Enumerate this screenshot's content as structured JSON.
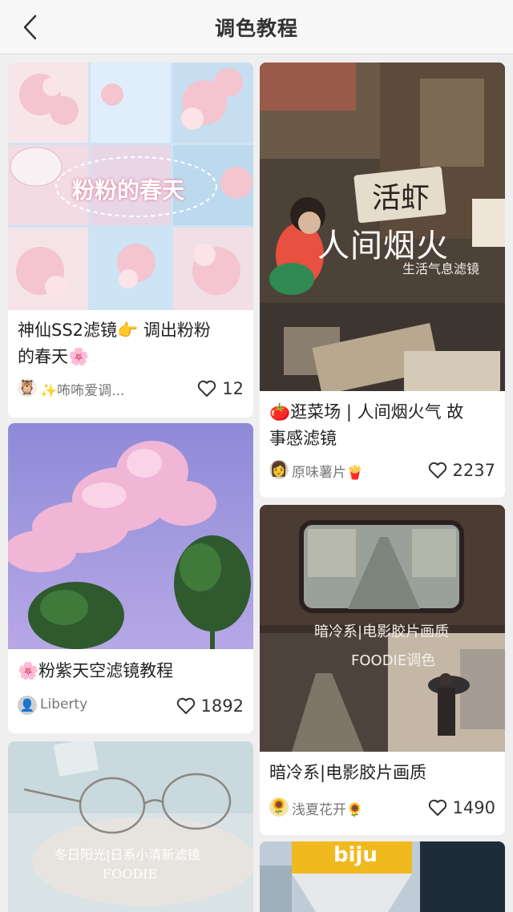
{
  "header": {
    "title": "调色教程"
  },
  "cards": [
    {
      "overlay": "粉粉的春天",
      "title": "神仙SS2滤镜👉 调出粉粉的春天🌸",
      "title_line1": "神仙SS2滤镜👉 调出粉粉",
      "title_line2": "的春天🌸",
      "avatar": "🦉",
      "author": "✨咘咘爱调...",
      "likes": "12"
    },
    {
      "overlay": "人间烟火",
      "overlay_sub": "生活气息滤镜",
      "sign": "活虾",
      "title_line1": "🍅逛菜场 | 人间烟火气 故",
      "title_line2": "事感滤镜",
      "avatar": "👩",
      "author": "原味薯片🍟",
      "likes": "2237"
    },
    {
      "title_line1": "🌸粉紫天空滤镜教程",
      "avatar": "👤",
      "author": "Liberty",
      "likes": "1892"
    },
    {
      "overlay": "暗冷系|电影胶片画质",
      "overlay_sub": "FOODIE调色",
      "title_line1": "暗冷系|电影胶片画质",
      "avatar": "🌻",
      "author": "浅夏花开🌻",
      "likes": "1490"
    },
    {
      "overlay": "冬日阳光|日系小清新滤镜",
      "overlay_sub": "FOODIE"
    },
    {
      "overlay": "biju"
    }
  ]
}
